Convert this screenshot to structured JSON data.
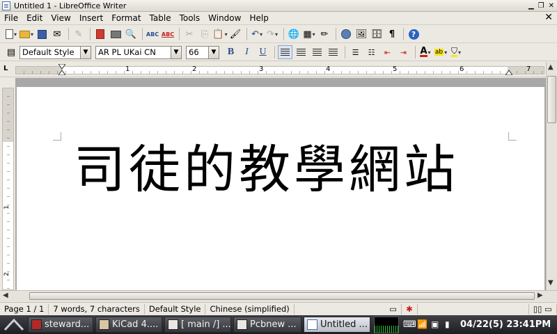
{
  "window": {
    "title": "Untitled 1 - LibreOffice Writer"
  },
  "menu": [
    "File",
    "Edit",
    "View",
    "Insert",
    "Format",
    "Table",
    "Tools",
    "Window",
    "Help"
  ],
  "format_toolbar": {
    "paragraph_style": "Default Style",
    "font_name": "AR PL UKai CN",
    "font_size": "66"
  },
  "ruler": {
    "h_numbers": [
      "1",
      "2",
      "3",
      "4",
      "5",
      "6",
      "7"
    ],
    "v_numbers": [
      "1",
      "2"
    ]
  },
  "document": {
    "text": "司徒的教學網站"
  },
  "status": {
    "page": "Page 1 / 1",
    "words": "7 words, 7 characters",
    "style": "Default Style",
    "language": "Chinese (simplified)"
  },
  "taskbar": {
    "tasks": [
      "steward...",
      "KiCad 4....",
      "[ main /] ...",
      "Pcbnew ...",
      "Untitled ..."
    ],
    "clock": "04/22(5) 23:41PM"
  },
  "colors": {
    "font_color": "#c8201c",
    "highlight": "#f7e51c",
    "taskbar_bg": "#2b2c30"
  }
}
